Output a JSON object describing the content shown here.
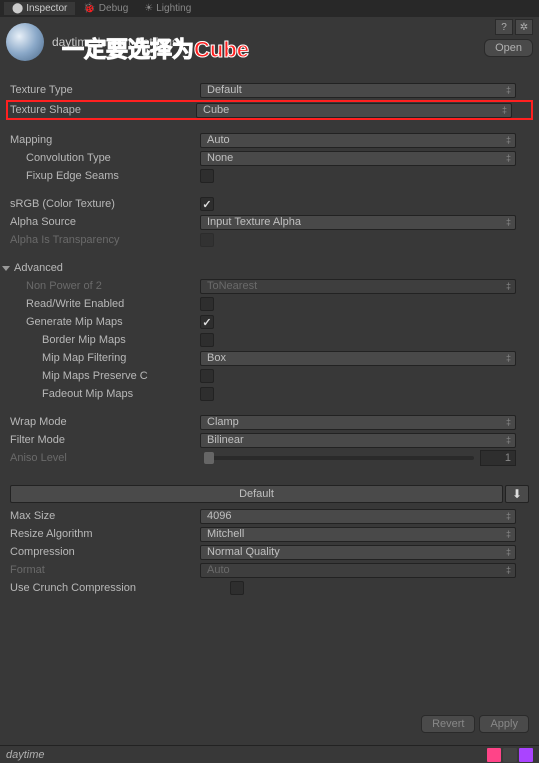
{
  "tabs": {
    "inspector": "Inspector",
    "debug": "Debug",
    "lighting": "Lighting"
  },
  "header": {
    "title": "daytime Import Settings",
    "open": "Open"
  },
  "annotation": "一定要选择为Cube",
  "rows": {
    "textureType": {
      "label": "Texture Type",
      "value": "Default"
    },
    "textureShape": {
      "label": "Texture Shape",
      "value": "Cube"
    },
    "mapping": {
      "label": "Mapping",
      "value": "Auto"
    },
    "convolutionType": {
      "label": "Convolution Type",
      "value": "None"
    },
    "fixupEdgeSeams": {
      "label": "Fixup Edge Seams"
    },
    "srgb": {
      "label": "sRGB (Color Texture)"
    },
    "alphaSource": {
      "label": "Alpha Source",
      "value": "Input Texture Alpha"
    },
    "alphaIsTransparency": {
      "label": "Alpha Is Transparency"
    },
    "advanced": {
      "label": "Advanced"
    },
    "nonPowerOf2": {
      "label": "Non Power of 2",
      "value": "ToNearest"
    },
    "readWrite": {
      "label": "Read/Write Enabled"
    },
    "generateMipMaps": {
      "label": "Generate Mip Maps"
    },
    "borderMipMaps": {
      "label": "Border Mip Maps"
    },
    "mipMapFiltering": {
      "label": "Mip Map Filtering",
      "value": "Box"
    },
    "mipMapsPreserve": {
      "label": "Mip Maps Preserve C"
    },
    "fadeoutMipMaps": {
      "label": "Fadeout Mip Maps"
    },
    "wrapMode": {
      "label": "Wrap Mode",
      "value": "Clamp"
    },
    "filterMode": {
      "label": "Filter Mode",
      "value": "Bilinear"
    },
    "anisoLevel": {
      "label": "Aniso Level",
      "value": "1"
    },
    "default": {
      "label": "Default"
    },
    "maxSize": {
      "label": "Max Size",
      "value": "4096"
    },
    "resizeAlgorithm": {
      "label": "Resize Algorithm",
      "value": "Mitchell"
    },
    "compression": {
      "label": "Compression",
      "value": "Normal Quality"
    },
    "format": {
      "label": "Format",
      "value": "Auto"
    },
    "useCrunch": {
      "label": "Use Crunch Compression"
    }
  },
  "buttons": {
    "revert": "Revert",
    "apply": "Apply"
  },
  "footer": {
    "label": "daytime"
  },
  "colors": {
    "highlight": "#ff2020",
    "footerChips": [
      "#ff4488",
      "#444444",
      "#aa44ff"
    ]
  }
}
